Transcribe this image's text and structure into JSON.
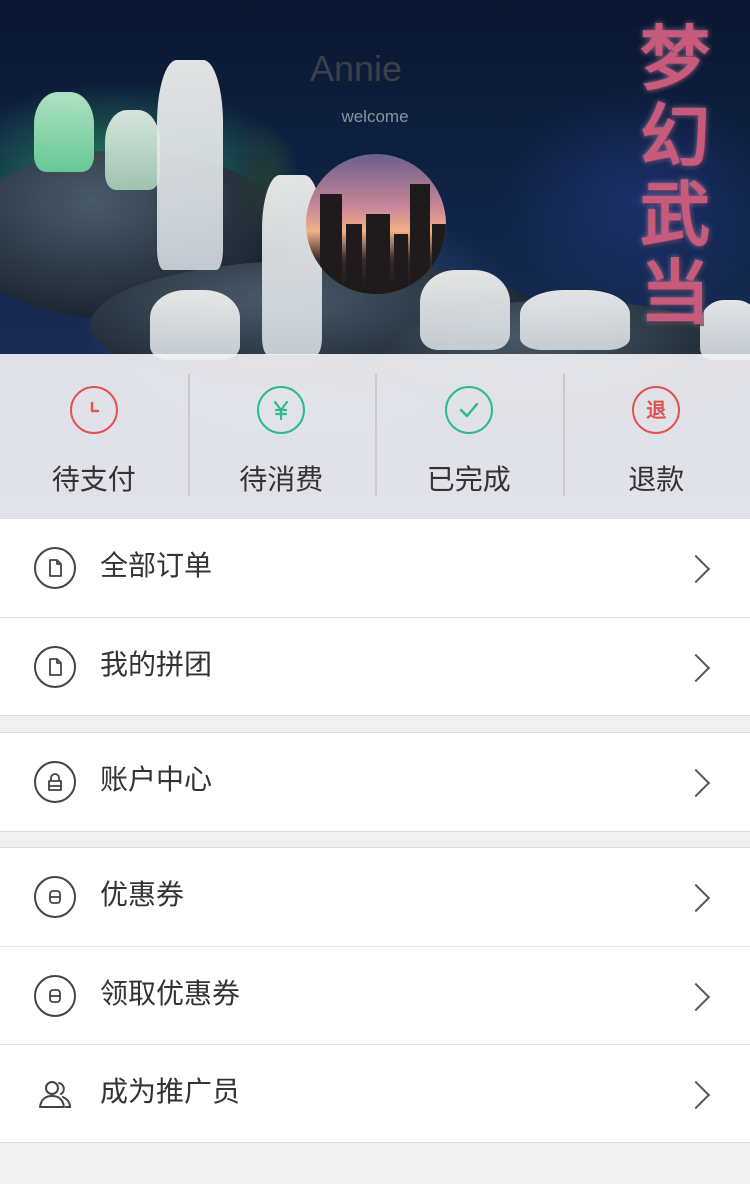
{
  "header": {
    "username": "Annie",
    "welcome": "welcome",
    "banner_title": [
      "梦",
      "幻",
      "武",
      "当"
    ]
  },
  "order_status": [
    {
      "label": "待支付",
      "icon": "clock-icon",
      "icon_color": "#e0534f"
    },
    {
      "label": "待消费",
      "icon": "yen-icon",
      "icon_color": "#2dba8d"
    },
    {
      "label": "已完成",
      "icon": "check-icon",
      "icon_color": "#2dba8d"
    },
    {
      "label": "退款",
      "icon": "refund-icon",
      "icon_text": "退",
      "icon_color": "#e0534f"
    }
  ],
  "menu": {
    "orders": [
      {
        "label": "全部订单",
        "icon": "document-icon"
      },
      {
        "label": "我的拼团",
        "icon": "document-icon"
      }
    ],
    "account": [
      {
        "label": "账户中心",
        "icon": "lock-icon"
      }
    ],
    "promos": [
      {
        "label": "优惠券",
        "icon": "coupon-icon"
      },
      {
        "label": "领取优惠券",
        "icon": "coupon-icon"
      },
      {
        "label": "成为推广员",
        "icon": "users-icon"
      }
    ]
  },
  "colors": {
    "accent_red": "#e0534f",
    "accent_green": "#2dba8d",
    "page_bg": "#f0f0f1"
  }
}
